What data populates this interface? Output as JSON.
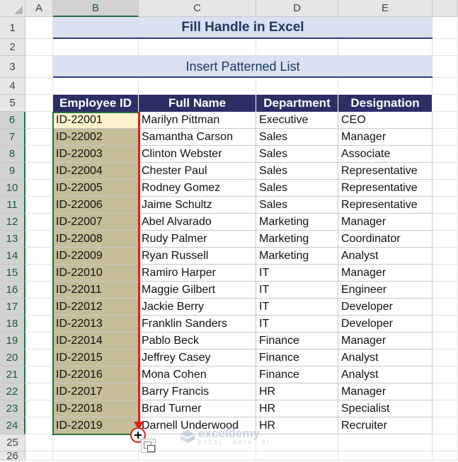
{
  "columns": [
    "A",
    "B",
    "C",
    "D",
    "E"
  ],
  "selected_column": "B",
  "row_numbers": [
    "1",
    "2",
    "3",
    "4",
    "5",
    "6",
    "7",
    "8",
    "9",
    "10",
    "11",
    "12",
    "13",
    "14",
    "15",
    "16",
    "17",
    "18",
    "19",
    "20",
    "21",
    "22",
    "23",
    "24",
    "25",
    "26"
  ],
  "title": "Fill Handle in Excel",
  "subtitle": "Insert Patterned List",
  "table": {
    "headers": [
      "Employee ID",
      "Full Name",
      "Department",
      "Designation"
    ],
    "rows": [
      [
        "ID-22001",
        "Marilyn Pittman",
        "Executive",
        "CEO"
      ],
      [
        "ID-22002",
        "Samantha Carson",
        "Sales",
        "Manager"
      ],
      [
        "ID-22003",
        "Clinton Webster",
        "Sales",
        "Associate"
      ],
      [
        "ID-22004",
        "Chester Paul",
        "Sales",
        "Representative"
      ],
      [
        "ID-22005",
        "Rodney Gomez",
        "Sales",
        "Representative"
      ],
      [
        "ID-22006",
        "Jaime Schultz",
        "Sales",
        "Representative"
      ],
      [
        "ID-22007",
        "Abel Alvarado",
        "Marketing",
        "Manager"
      ],
      [
        "ID-22008",
        "Rudy Palmer",
        "Marketing",
        "Coordinator"
      ],
      [
        "ID-22009",
        "Ryan Russell",
        "Marketing",
        "Analyst"
      ],
      [
        "ID-22010",
        "Ramiro Harper",
        "IT",
        "Manager"
      ],
      [
        "ID-22011",
        "Maggie Gilbert",
        "IT",
        "Engineer"
      ],
      [
        "ID-22012",
        "Jackie Berry",
        "IT",
        "Developer"
      ],
      [
        "ID-22013",
        "Franklin Sanders",
        "IT",
        "Developer"
      ],
      [
        "ID-22014",
        "Pablo Beck",
        "Finance",
        "Manager"
      ],
      [
        "ID-22015",
        "Jeffrey Casey",
        "Finance",
        "Analyst"
      ],
      [
        "ID-22016",
        "Mona Cohen",
        "Finance",
        "Analyst"
      ],
      [
        "ID-22017",
        "Barry Francis",
        "HR",
        "Manager"
      ],
      [
        "ID-22018",
        "Brad Turner",
        "HR",
        "Specialist"
      ],
      [
        "ID-22019",
        "Darnell Underwood",
        "HR",
        "Recruiter"
      ]
    ]
  },
  "watermark": {
    "name": "exceldemy",
    "tagline": "EXCEL · DATA · BI"
  },
  "colors": {
    "header_fill": "#2b2f66",
    "title_fill": "#d9e1f2",
    "id_fill": "#c4bd97",
    "active_cell_fill": "#fff2cc",
    "selection_border": "#217346",
    "fill_arrow": "#e11d1d"
  },
  "icons": {
    "fill_handle_cursor": "crosshair-plus-icon",
    "autofill_options": "auto-fill-options-icon"
  }
}
